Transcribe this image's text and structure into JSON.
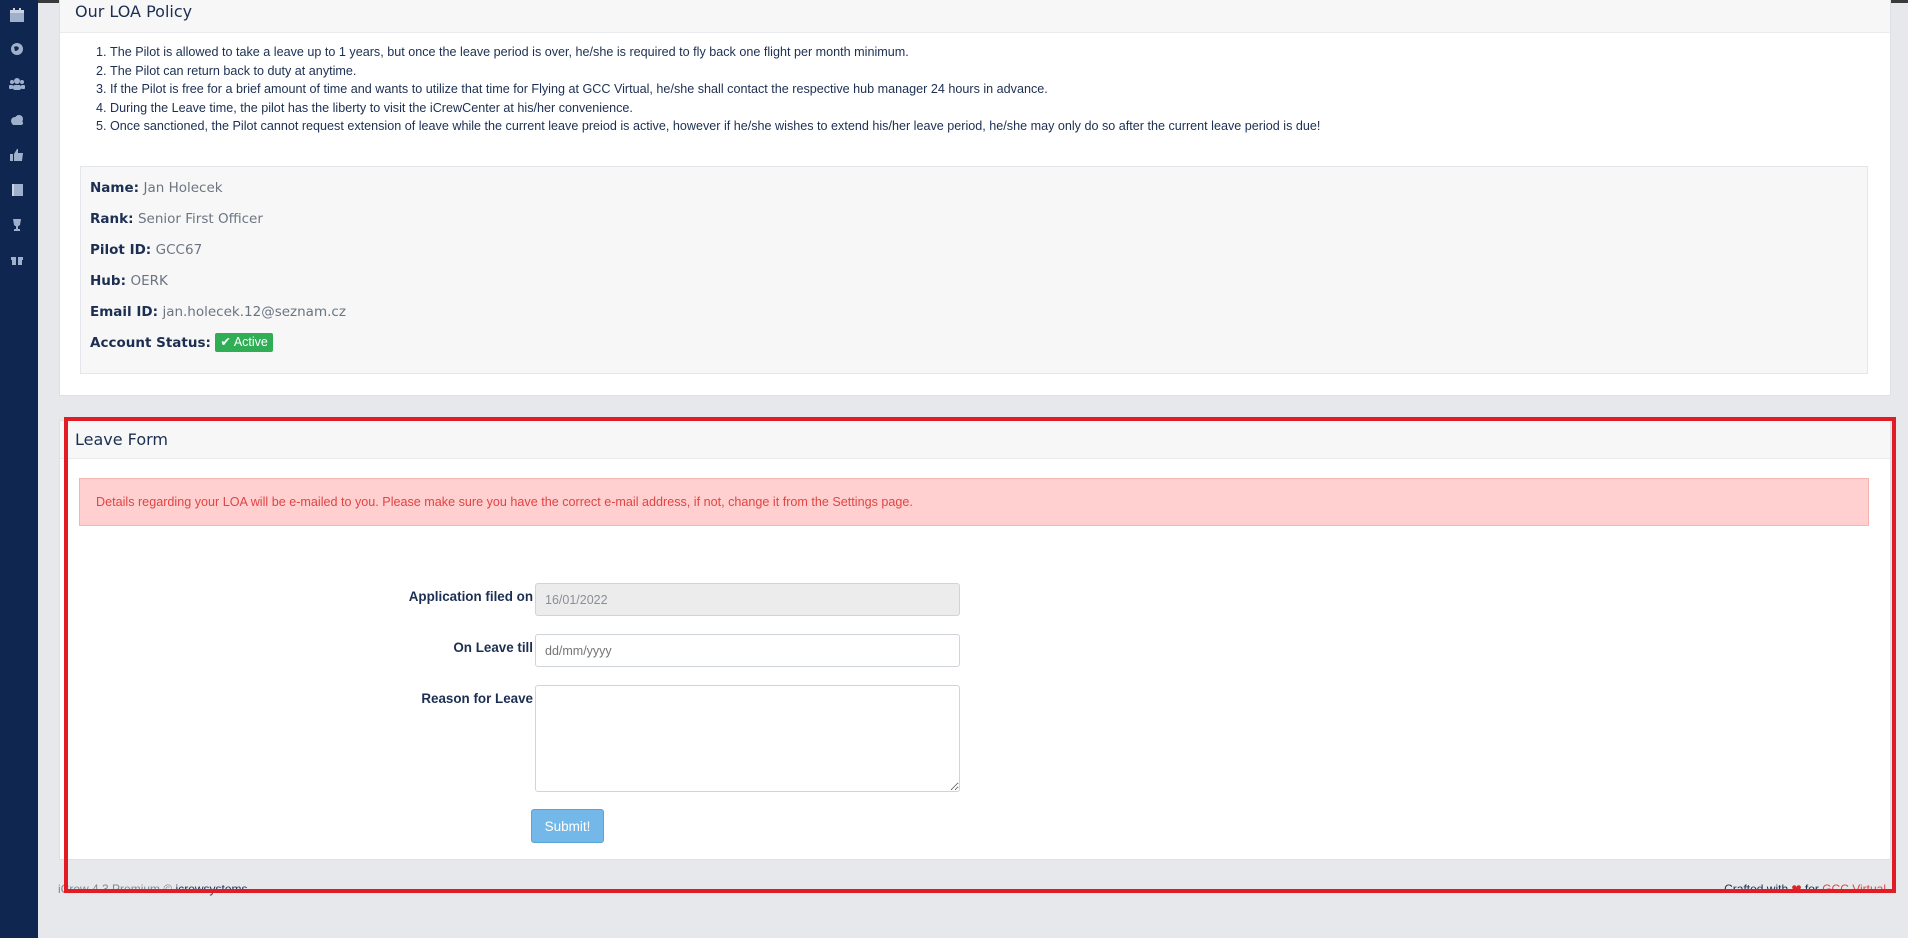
{
  "sidebar": {
    "icons": [
      "calendar-icon",
      "globe-icon",
      "users-icon",
      "cloud-icon",
      "thumbs-up-icon",
      "book-icon",
      "trophy-icon",
      "gift-icon"
    ]
  },
  "policy": {
    "title": "Our LOA Policy",
    "rules": [
      "The Pilot is allowed to take a leave up to 1 years, but once the leave period is over, he/she is required to fly back one flight per month minimum.",
      "The Pilot can return back to duty at anytime.",
      "If the Pilot is free for a brief amount of time and wants to utilize that time for Flying at GCC Virtual, he/she shall contact the respective hub manager 24 hours in advance.",
      "During the Leave time, the pilot has the liberty to visit the iCrewCenter at his/her convenience.",
      "Once sanctioned, the Pilot cannot request extension of leave while the current leave preiod is active, however if he/she wishes to extend his/her leave period, he/she may only do so after the current leave period is due!"
    ]
  },
  "pilot": {
    "name_label": "Name:",
    "name": "Jan Holecek",
    "rank_label": "Rank:",
    "rank": "Senior First Officer",
    "id_label": "Pilot ID:",
    "id": "GCC67",
    "hub_label": "Hub:",
    "hub": "OERK",
    "email_label": "Email ID:",
    "email": "jan.holecek.12@seznam.cz",
    "status_label": "Account Status:",
    "status": "Active"
  },
  "leave_form": {
    "title": "Leave Form",
    "alert": "Details regarding your LOA will be e-mailed to you. Please make sure you have the correct e-mail address, if not, change it from the Settings page.",
    "filed_label": "Application filed on",
    "filed_value": "16/01/2022",
    "till_label": "On Leave till",
    "till_placeholder": "dd/mm/yyyy",
    "reason_label": "Reason for Leave",
    "reason_value": "",
    "submit_label": "Submit!"
  },
  "footer": {
    "left_text": "iCrew 4.3 Premium © ",
    "left_link": "icrewsystems",
    "right_text": "Crafted with ",
    "right_for": " for ",
    "right_link": "GCC Virtual"
  },
  "colors": {
    "sidebar": "#0e2650",
    "highlight_border": "#e21b25",
    "badge": "#2fae55",
    "alert_bg": "#ffd0cf"
  }
}
